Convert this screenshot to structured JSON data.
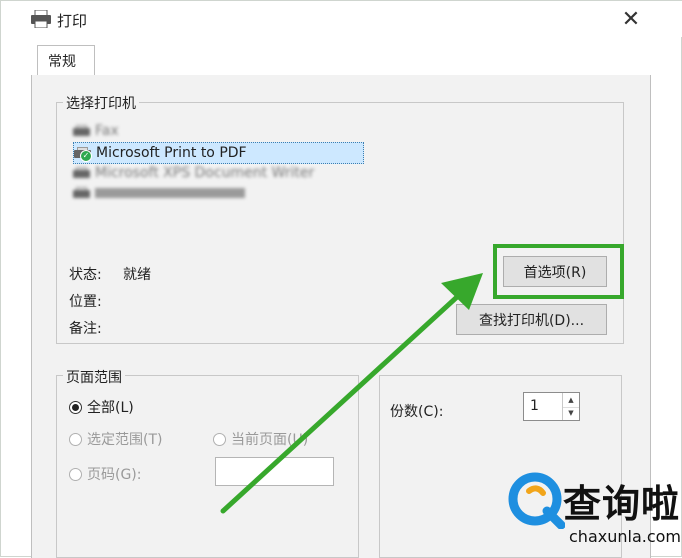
{
  "window": {
    "title": "打印",
    "close_label": "✕"
  },
  "tabs": [
    {
      "label": "常规"
    }
  ],
  "printer_group": {
    "label": "选择打印机",
    "printers": [
      {
        "name": "Fax",
        "selected": false,
        "blurred": true
      },
      {
        "name": "Microsoft Print to PDF",
        "selected": true,
        "blurred": false
      },
      {
        "name": "Microsoft XPS Document Writer",
        "selected": false,
        "blurred": true
      },
      {
        "name": " ",
        "selected": false,
        "blurred": true
      }
    ],
    "status_label": "状态:",
    "status_value": "就绪",
    "location_label": "位置:",
    "comment_label": "备注:",
    "preferences_button": "首选项(R)",
    "find_printer_button": "查找打印机(D)..."
  },
  "page_range": {
    "label": "页面范围",
    "all": "全部(L)",
    "selection": "选定范围(T)",
    "current_page": "当前页面(U)",
    "pages": "页码(G):",
    "selected_option": "all"
  },
  "copies": {
    "label": "份数(C):",
    "value": "1"
  },
  "watermark": {
    "cn": "查询啦",
    "en": "chaxunla.com"
  },
  "colors": {
    "highlight": "#37a82c",
    "selection": "#cde8ff",
    "accent_arrow": "#37a82c"
  }
}
